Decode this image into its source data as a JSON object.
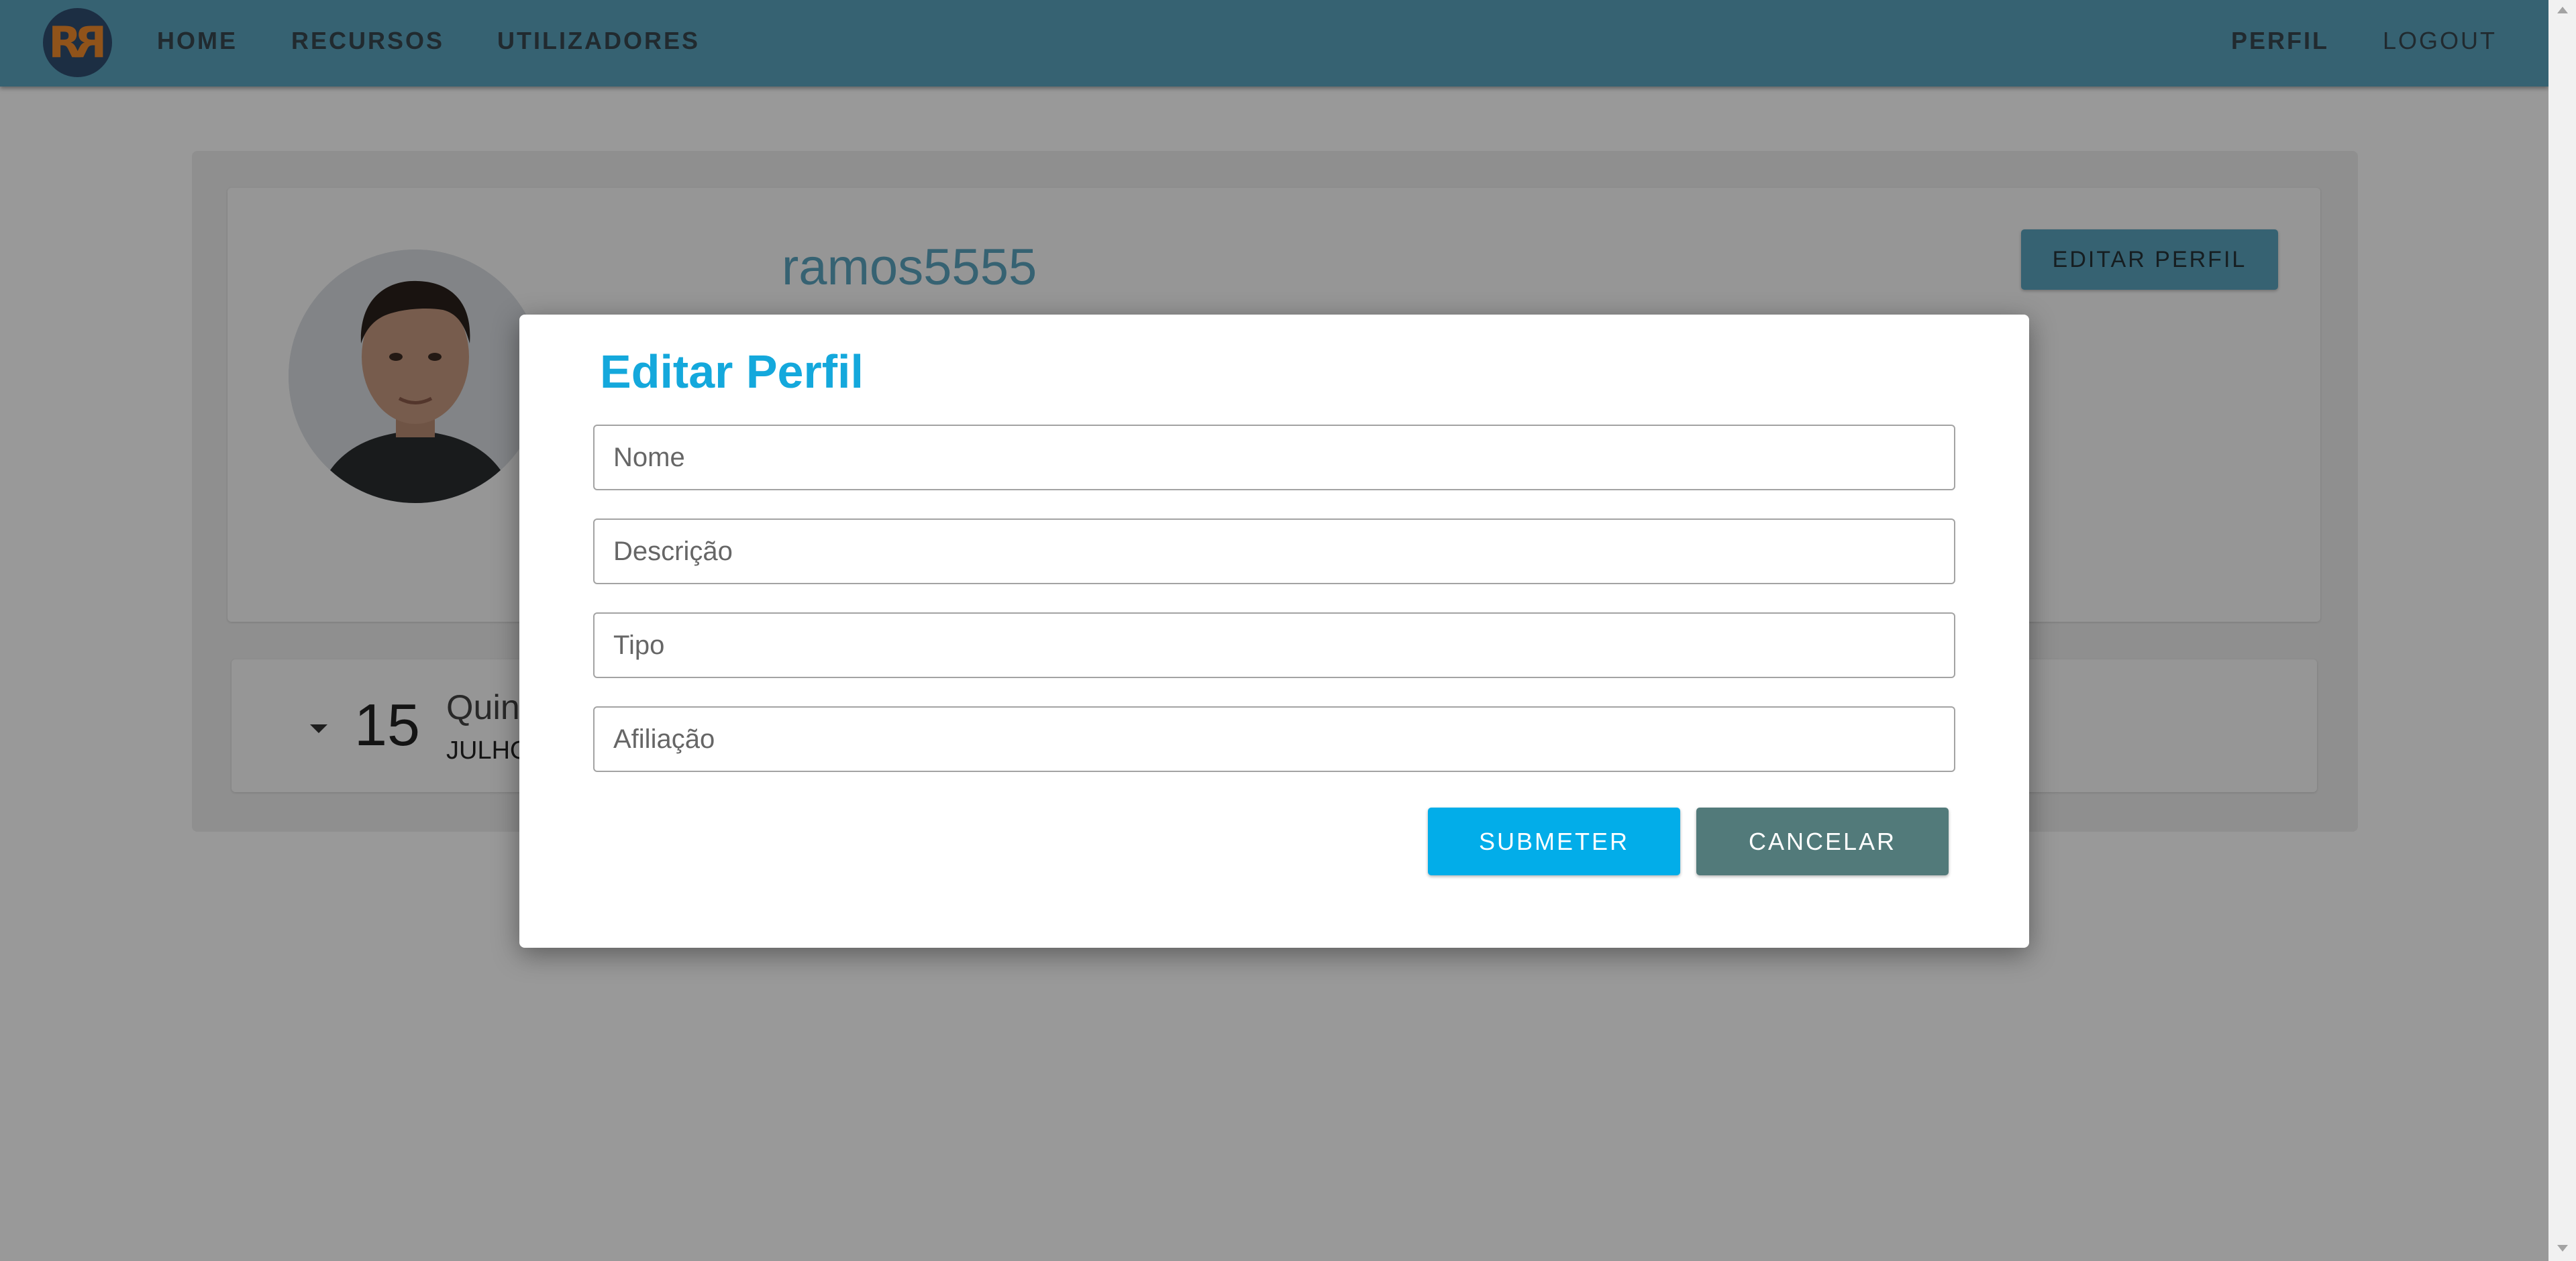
{
  "navbar": {
    "logo_text": "RR",
    "items": [
      "HOME",
      "RECURSOS",
      "UTILIZADORES"
    ],
    "right_items": [
      "PERFIL",
      "LOGOUT"
    ]
  },
  "profile": {
    "username": "ramos5555",
    "edit_button": "EDITAR PERFIL"
  },
  "event": {
    "day": "15",
    "weekday_partial": "Quint",
    "month_partial": "JULHO"
  },
  "modal": {
    "title": "Editar Perfil",
    "fields": [
      {
        "placeholder": "Nome",
        "value": ""
      },
      {
        "placeholder": "Descrição",
        "value": ""
      },
      {
        "placeholder": "Tipo",
        "value": ""
      },
      {
        "placeholder": "Afiliação",
        "value": ""
      }
    ],
    "submit_label": "SUBMETER",
    "cancel_label": "CANCELAR"
  },
  "colors": {
    "navbar": "#5aa4bf",
    "title_accent": "#14a8dc",
    "submit": "#02ade9",
    "cancel": "#527a7a",
    "logo_bg": "#2f4d70",
    "logo_fg": "#f08a2c"
  }
}
